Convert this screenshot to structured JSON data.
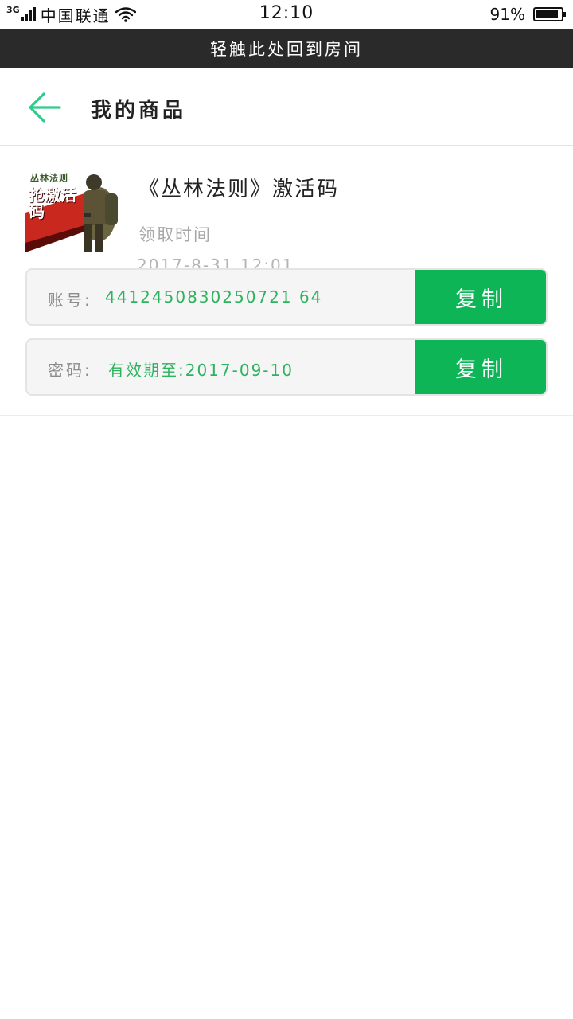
{
  "status_bar": {
    "network": "3G",
    "carrier": "中国联通",
    "time": "12:10",
    "battery": "91%",
    "battery_level": 0.91
  },
  "return_bar": {
    "label": "轻触此处回到房间"
  },
  "header": {
    "back_icon": "arrow-left-icon",
    "title": "我的商品"
  },
  "product": {
    "name": "《丛林法则》激活码",
    "thumbnail": {
      "game_name": "丛林法则",
      "badge": "抢激活码"
    },
    "claim_label": "领取时间",
    "claim_time": "2017-8-31 12:01",
    "account": {
      "label": "账号:",
      "value": "4412450830250721 64",
      "copy_label": "复制"
    },
    "password": {
      "label": "密码:",
      "value": "有效期至:2017-09-10",
      "copy_label": "复制"
    }
  },
  "colors": {
    "accent_green": "#0db557",
    "value_green": "#2bb35e",
    "back_arrow": "#2ecc8a",
    "dark_bar": "#2a2a2a"
  }
}
